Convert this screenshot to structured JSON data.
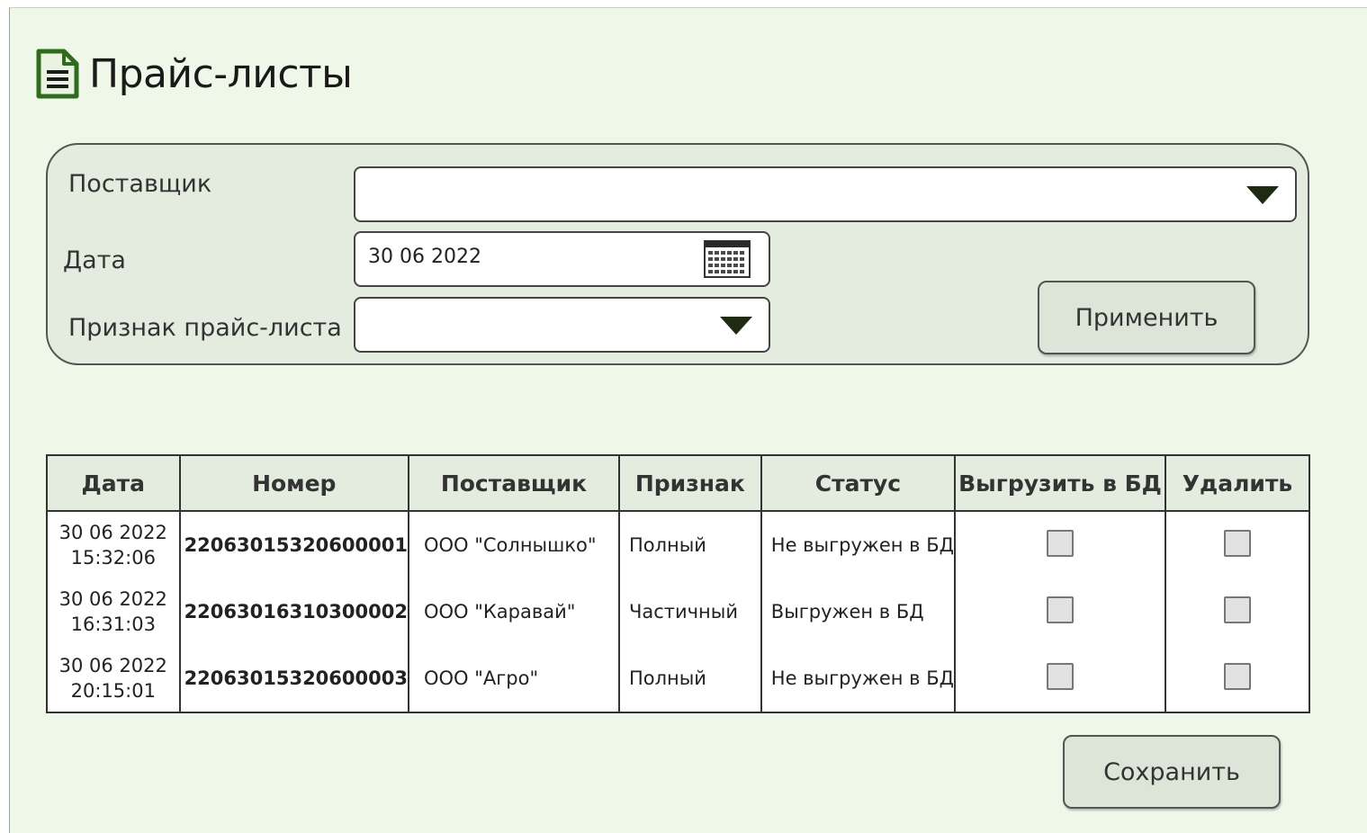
{
  "header": {
    "title": "Прайс-листы",
    "icon": "document-icon"
  },
  "filters": {
    "supplier_label": "Поставщик",
    "supplier_value": "",
    "date_label": "Дата",
    "date_value": "30 06 2022",
    "type_label": "Признак прайс-листа",
    "type_value": "",
    "apply_label": "Применить"
  },
  "table": {
    "columns": [
      "Дата",
      "Номер",
      "Поставщик",
      "Признак",
      "Статус",
      "Выгрузить в БД",
      "Удалить"
    ],
    "rows": [
      {
        "date": "30 06 2022",
        "time": "15:32:06",
        "number": "22063015320600001",
        "supplier": "ООО \"Солнышко\"",
        "type": "Полный",
        "status": "Не выгружен в БД",
        "export": false,
        "delete": false
      },
      {
        "date": "30 06 2022",
        "time": "16:31:03",
        "number": "22063016310300002",
        "supplier": "ООО \"Каравай\"",
        "type": "Частичный",
        "status": "Выгружен в БД",
        "export": false,
        "delete": false
      },
      {
        "date": "30 06 2022",
        "time": "20:15:01",
        "number": "22063015320600003",
        "supplier": "ООО \"Агро\"",
        "type": "Полный",
        "status": "Не выгружен в БД",
        "export": false,
        "delete": false
      }
    ]
  },
  "footer": {
    "save_label": "Сохранить"
  },
  "colors": {
    "background": "#eff8e8",
    "panel": "#e4ece0",
    "link": "#3b3bd6",
    "icon": "#2f6b1f"
  }
}
